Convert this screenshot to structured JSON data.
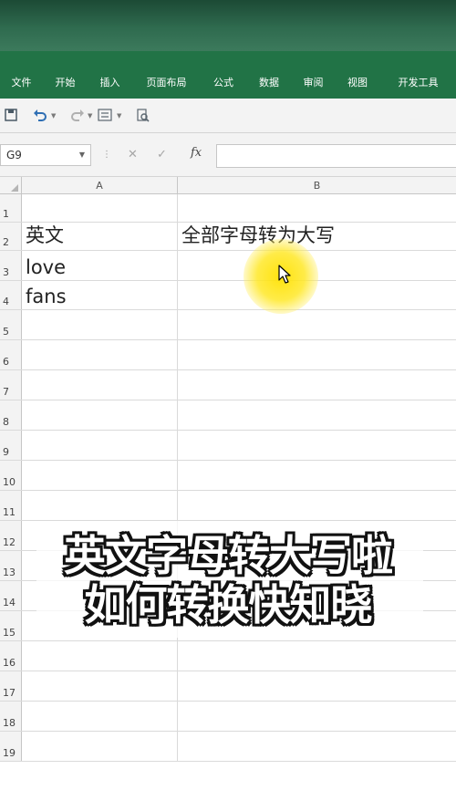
{
  "ribbon": {
    "tabs": [
      "文件",
      "开始",
      "插入",
      "页面布局",
      "公式",
      "数据",
      "审阅",
      "视图",
      "开发工具"
    ]
  },
  "formula_bar": {
    "name_box": "G9",
    "fx_label": "fx",
    "value": ""
  },
  "columns": [
    "A",
    "B"
  ],
  "rows": [
    {
      "num": "1",
      "a": "",
      "b": ""
    },
    {
      "num": "2",
      "a": "英文",
      "b": "全部字母转为大写"
    },
    {
      "num": "3",
      "a": "love",
      "b": ""
    },
    {
      "num": "4",
      "a": "fans",
      "b": ""
    },
    {
      "num": "5",
      "a": "",
      "b": ""
    },
    {
      "num": "6",
      "a": "",
      "b": ""
    },
    {
      "num": "7",
      "a": "",
      "b": ""
    },
    {
      "num": "8",
      "a": "",
      "b": ""
    },
    {
      "num": "9",
      "a": "",
      "b": ""
    },
    {
      "num": "10",
      "a": "",
      "b": ""
    },
    {
      "num": "11",
      "a": "",
      "b": ""
    },
    {
      "num": "12",
      "a": "",
      "b": ""
    },
    {
      "num": "13",
      "a": "",
      "b": ""
    },
    {
      "num": "14",
      "a": "",
      "b": ""
    },
    {
      "num": "15",
      "a": "",
      "b": ""
    },
    {
      "num": "16",
      "a": "",
      "b": ""
    },
    {
      "num": "17",
      "a": "",
      "b": ""
    },
    {
      "num": "18",
      "a": "",
      "b": ""
    },
    {
      "num": "19",
      "a": "",
      "b": ""
    }
  ],
  "caption": {
    "line1": "英文字母转大写啦",
    "line2": "如何转换快知晓"
  },
  "colors": {
    "ribbon": "#217346",
    "highlight": "#ffe100"
  }
}
